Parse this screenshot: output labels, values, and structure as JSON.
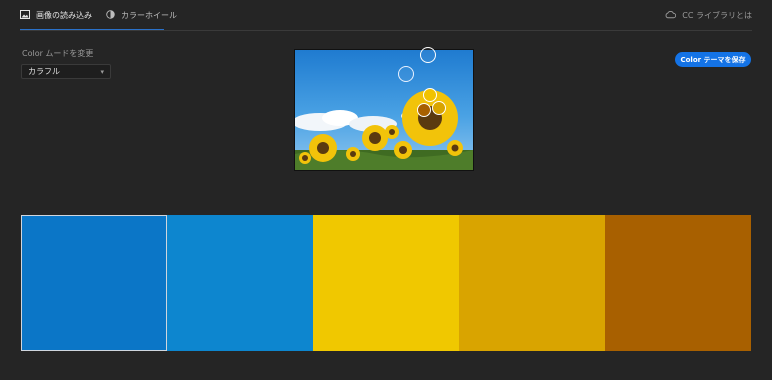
{
  "tabs": [
    {
      "label": "画像の読み込み",
      "icon": "image-icon",
      "active": true
    },
    {
      "label": "カラーホイール",
      "icon": "color-wheel-icon",
      "active": false
    }
  ],
  "cc_link": {
    "label": "CC ライブラリとは",
    "icon": "creative-cloud-icon"
  },
  "mood": {
    "label": "Color ムードを変更",
    "value": "カラフル"
  },
  "save_button": {
    "label": "Color テーマを保存"
  },
  "swatches": [
    {
      "color": "#0b76c7",
      "selected": true
    },
    {
      "color": "#0d86cf",
      "selected": false
    },
    {
      "color": "#f0c800",
      "selected": false
    },
    {
      "color": "#d9a400",
      "selected": false
    },
    {
      "color": "#a86000",
      "selected": false
    }
  ],
  "colors": {
    "accent": "#1473e6",
    "background": "#252525"
  }
}
